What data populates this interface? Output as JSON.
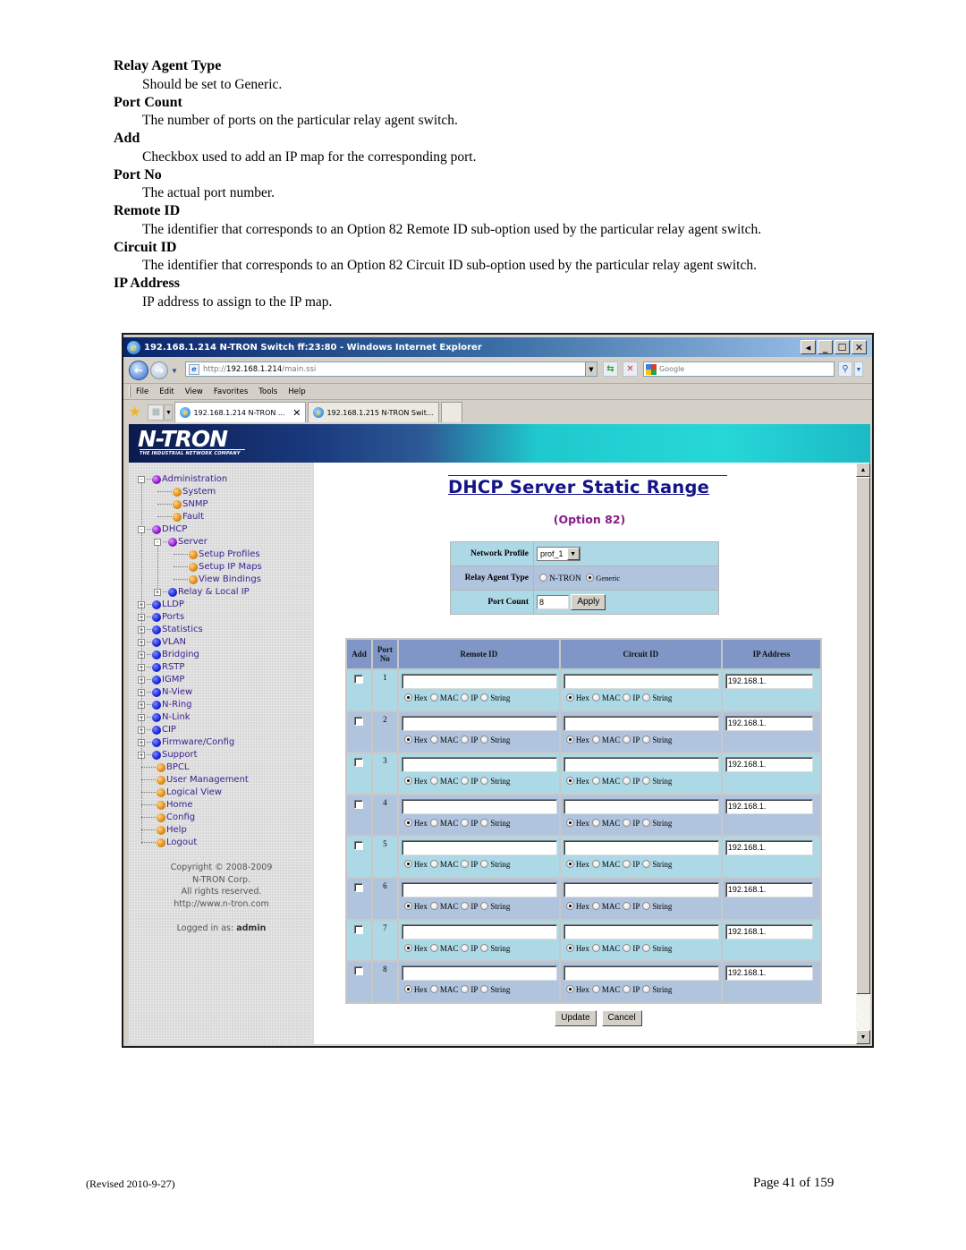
{
  "document": {
    "entries": [
      {
        "term": "Relay Agent Type",
        "definition": "Should be set to Generic."
      },
      {
        "term": "Port Count",
        "definition": "The number of ports on the particular relay agent switch."
      },
      {
        "term": "Add",
        "definition": "Checkbox used to add an IP map for the corresponding port."
      },
      {
        "term": "Port No",
        "definition": "The actual port number."
      },
      {
        "term": "Remote ID",
        "definition": "The identifier that corresponds to an Option 82 Remote ID sub-option used by the particular relay agent switch."
      },
      {
        "term": "Circuit ID",
        "definition": "The identifier that corresponds to an Option 82 Circuit ID sub-option used by the particular relay agent switch."
      },
      {
        "term": "IP Address",
        "definition": "IP address to assign to the IP map."
      }
    ],
    "footer_left": "(Revised 2010-9-27)",
    "footer_right": "Page 41 of 159"
  },
  "browser": {
    "title": "192.168.1.214 N-TRON Switch ff:23:80 - Windows Internet Explorer",
    "window_buttons": [
      "◂",
      "_",
      "☐",
      "✕"
    ],
    "url_proto": "http://",
    "url_host": "192.168.1.214",
    "url_path": "/main.ssi",
    "search_placeholder": "Google",
    "menu": [
      "File",
      "Edit",
      "View",
      "Favorites",
      "Tools",
      "Help"
    ],
    "menu_accel": [
      "F",
      "E",
      "V",
      "a",
      "T",
      "H"
    ],
    "tabs": [
      {
        "label": "192.168.1.214 N-TRON ...",
        "active": true
      },
      {
        "label": "192.168.1.215 N-TRON Swit...",
        "active": false
      }
    ]
  },
  "banner": {
    "logo": "N-TRON",
    "tagline": "THE INDUSTRIAL NETWORK COMPANY"
  },
  "sidebar": {
    "items": [
      {
        "label": "Administration",
        "bullet": "purple",
        "expander": "−"
      },
      {
        "label": "System",
        "bullet": "orange"
      },
      {
        "label": "SNMP",
        "bullet": "orange"
      },
      {
        "label": "Fault",
        "bullet": "orange"
      },
      {
        "label": "DHCP",
        "bullet": "purple",
        "expander": "−"
      },
      {
        "label": "Server",
        "bullet": "purple",
        "expander": "−"
      },
      {
        "label": "Setup Profiles",
        "bullet": "orange"
      },
      {
        "label": "Setup IP Maps",
        "bullet": "orange"
      },
      {
        "label": "View Bindings",
        "bullet": "orange"
      },
      {
        "label": "Relay & Local IP",
        "bullet": "blue",
        "expander": "+"
      },
      {
        "label": "LLDP",
        "bullet": "blue",
        "expander": "+"
      },
      {
        "label": "Ports",
        "bullet": "blue",
        "expander": "+"
      },
      {
        "label": "Statistics",
        "bullet": "blue",
        "expander": "+"
      },
      {
        "label": "VLAN",
        "bullet": "blue",
        "expander": "+"
      },
      {
        "label": "Bridging",
        "bullet": "blue",
        "expander": "+"
      },
      {
        "label": "RSTP",
        "bullet": "blue",
        "expander": "+"
      },
      {
        "label": "IGMP",
        "bullet": "blue",
        "expander": "+"
      },
      {
        "label": "N-View",
        "bullet": "blue",
        "expander": "+"
      },
      {
        "label": "N-Ring",
        "bullet": "blue",
        "expander": "+"
      },
      {
        "label": "N-Link",
        "bullet": "blue",
        "expander": "+"
      },
      {
        "label": "CIP",
        "bullet": "blue",
        "expander": "+"
      },
      {
        "label": "Firmware/Config",
        "bullet": "blue",
        "expander": "+"
      },
      {
        "label": "Support",
        "bullet": "blue",
        "expander": "+"
      },
      {
        "label": "BPCL",
        "bullet": "orange"
      },
      {
        "label": "User Management",
        "bullet": "orange"
      },
      {
        "label": "Logical View",
        "bullet": "orange"
      },
      {
        "label": "Home",
        "bullet": "orange"
      },
      {
        "label": "Config",
        "bullet": "orange"
      },
      {
        "label": "Help",
        "bullet": "orange"
      },
      {
        "label": "Logout",
        "bullet": "orange"
      }
    ],
    "copyright": "Copyright © 2008-2009",
    "company": "N-TRON Corp.",
    "rights": "All rights reserved.",
    "website": "http://www.n-tron.com",
    "logged_in_label": "Logged in as:",
    "logged_in_user": "admin"
  },
  "page": {
    "title": "DHCP Server Static Range",
    "subtitle": "(Option 82)",
    "network_profile_label": "Network Profile",
    "network_profile_value": "prof_1",
    "relay_agent_type_label": "Relay Agent Type",
    "relay_agent_options": [
      "N-TRON",
      "Generic"
    ],
    "relay_agent_selected": "Generic",
    "port_count_label": "Port Count",
    "port_count_value": "8",
    "apply_label": "Apply",
    "columns": {
      "add": "Add",
      "port_no_1": "Port",
      "port_no_2": "No",
      "remote_id": "Remote ID",
      "circuit_id": "Circuit ID",
      "ip_address": "IP Address"
    },
    "id_format_options": [
      "Hex",
      "MAC",
      "IP",
      "String"
    ],
    "rows": [
      {
        "port": "1",
        "add": false,
        "remote_id": "",
        "remote_format": "Hex",
        "circuit_id": "",
        "circuit_format": "Hex",
        "ip": "192.168.1."
      },
      {
        "port": "2",
        "add": false,
        "remote_id": "",
        "remote_format": "Hex",
        "circuit_id": "",
        "circuit_format": "Hex",
        "ip": "192.168.1."
      },
      {
        "port": "3",
        "add": false,
        "remote_id": "",
        "remote_format": "Hex",
        "circuit_id": "",
        "circuit_format": "Hex",
        "ip": "192.168.1."
      },
      {
        "port": "4",
        "add": false,
        "remote_id": "",
        "remote_format": "Hex",
        "circuit_id": "",
        "circuit_format": "Hex",
        "ip": "192.168.1."
      },
      {
        "port": "5",
        "add": false,
        "remote_id": "",
        "remote_format": "Hex",
        "circuit_id": "",
        "circuit_format": "Hex",
        "ip": "192.168.1."
      },
      {
        "port": "6",
        "add": false,
        "remote_id": "",
        "remote_format": "Hex",
        "circuit_id": "",
        "circuit_format": "Hex",
        "ip": "192.168.1."
      },
      {
        "port": "7",
        "add": false,
        "remote_id": "",
        "remote_format": "Hex",
        "circuit_id": "",
        "circuit_format": "Hex",
        "ip": "192.168.1."
      },
      {
        "port": "8",
        "add": false,
        "remote_id": "",
        "remote_format": "Hex",
        "circuit_id": "",
        "circuit_format": "Hex",
        "ip": "192.168.1."
      }
    ],
    "update_label": "Update",
    "cancel_label": "Cancel"
  },
  "colors": {
    "row_odd": "#add8e6",
    "row_even": "#b0c4de",
    "header": "#7f96c6",
    "title": "#14148a",
    "subtitle": "#8a1a8a",
    "sidebar_link": "#3a1f8f"
  }
}
